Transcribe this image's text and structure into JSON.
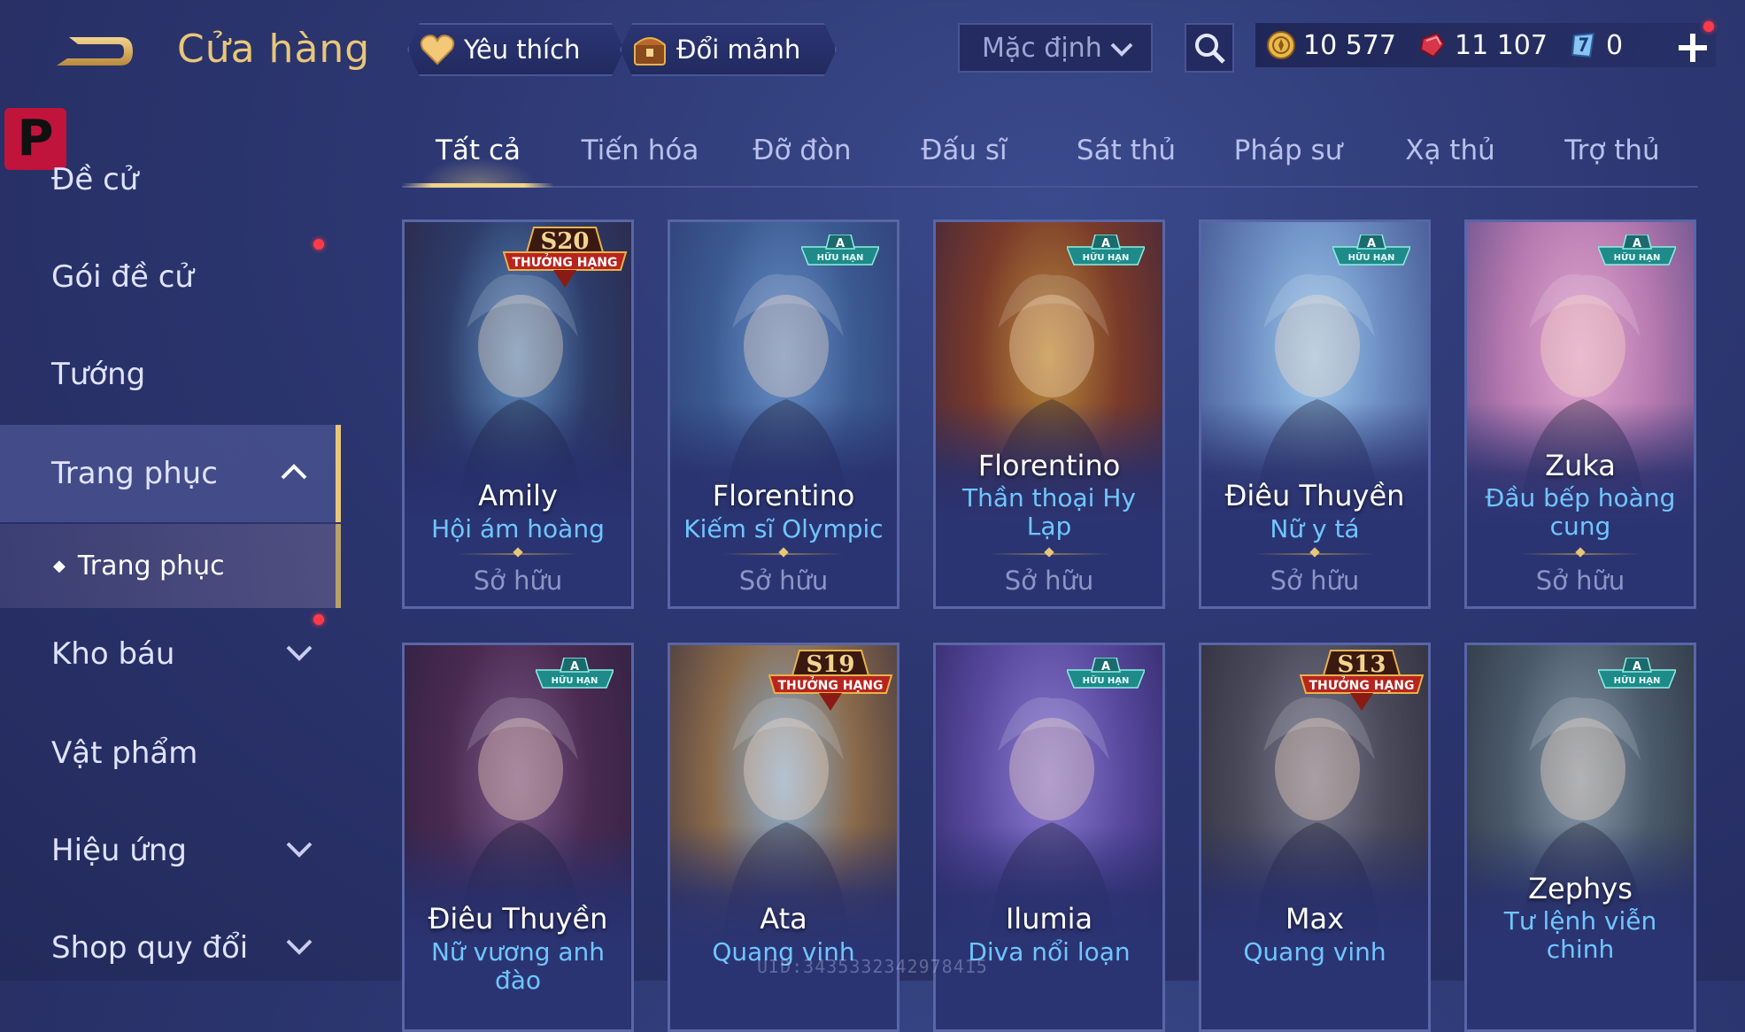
{
  "header": {
    "title": "Cửa hàng",
    "favorite_label": "Yêu thích",
    "fragment_label": "Đổi mảnh",
    "sort_value": "Mặc định",
    "currencies": [
      {
        "name": "gold-coin",
        "value": "10 577"
      },
      {
        "name": "ruby",
        "value": "11 107"
      },
      {
        "name": "voucher",
        "value": "0"
      }
    ]
  },
  "sidebar": {
    "logo_letter": "P",
    "items": [
      {
        "label": "Đề cử"
      },
      {
        "label": "Gói đề cử"
      },
      {
        "label": "Tướng"
      },
      {
        "label": "Trang phục"
      },
      {
        "label": "Trang phục"
      },
      {
        "label": "Kho báu"
      },
      {
        "label": "Vật phẩm"
      },
      {
        "label": "Hiệu ứng"
      },
      {
        "label": "Shop quy đổi"
      }
    ]
  },
  "tabs": [
    "Tất cả",
    "Tiến hóa",
    "Đỡ đòn",
    "Đấu sĩ",
    "Sát thủ",
    "Pháp sư",
    "Xạ thủ",
    "Trợ thủ"
  ],
  "cards": [
    {
      "hero": "Amily",
      "skin": "Hội ám hoàng",
      "status": "Sở hữu",
      "badge": "season",
      "season": "S20",
      "season_label": "THƯỞNG HẠNG",
      "colors": [
        "#5f8fc0",
        "#2d3c6a",
        "#2b2442"
      ]
    },
    {
      "hero": "Florentino",
      "skin": "Kiếm sĩ Olympic",
      "status": "Sở hữu",
      "badge": "limited",
      "badge_letter": "A",
      "badge_label": "HỮU HẠN",
      "colors": [
        "#6a90c8",
        "#3b5a92",
        "#2e3a70"
      ]
    },
    {
      "hero": "Florentino",
      "skin": "Thần thoại Hy Lạp",
      "status": "Sở hữu",
      "badge": "limited",
      "badge_letter": "A",
      "badge_label": "HỮU HẠN",
      "colors": [
        "#b88a3a",
        "#7a3a2a",
        "#3a2440"
      ]
    },
    {
      "hero": "Điêu Thuyền",
      "skin": "Nữ y tá",
      "status": "Sở hữu",
      "badge": "limited",
      "badge_letter": "A",
      "badge_label": "HỮU HẠN",
      "colors": [
        "#9cc8ec",
        "#6a8ac0",
        "#3c4a86"
      ]
    },
    {
      "hero": "Zuka",
      "skin": "Đầu bếp hoàng cung",
      "status": "Sở hữu",
      "badge": "limited",
      "badge_letter": "A",
      "badge_label": "HỮU HẠN",
      "colors": [
        "#e0a8d0",
        "#b87ab0",
        "#5a4a86"
      ]
    },
    {
      "hero": "Điêu Thuyền",
      "skin": "Nữ vương anh đào",
      "status": "",
      "badge": "limited",
      "badge_letter": "A",
      "badge_label": "HỮU HẠN",
      "colors": [
        "#7a5a8a",
        "#4a2a50",
        "#2a2040"
      ]
    },
    {
      "hero": "Ata",
      "skin": "Quang vinh",
      "status": "",
      "badge": "season",
      "season": "S19",
      "season_label": "THƯỞNG HẠNG",
      "colors": [
        "#8ab0d8",
        "#8a6a4a",
        "#3a3040"
      ]
    },
    {
      "hero": "Ilumia",
      "skin": "Diva nổi loạn",
      "status": "",
      "badge": "limited",
      "badge_letter": "A",
      "badge_label": "HỮU HẠN",
      "colors": [
        "#8a7ad0",
        "#5a4aa0",
        "#2a2460"
      ]
    },
    {
      "hero": "Max",
      "skin": "Quang vinh",
      "status": "",
      "badge": "season",
      "season": "S13",
      "season_label": "THƯỞNG HẠNG",
      "colors": [
        "#7a7a90",
        "#4a4a5a",
        "#2a2a3a"
      ]
    },
    {
      "hero": "Zephys",
      "skin": "Tư lệnh viễn chinh",
      "status": "",
      "badge": "limited",
      "badge_letter": "A",
      "badge_label": "HỮU HẠN",
      "colors": [
        "#8a9aac",
        "#4a5a6a",
        "#2a303e"
      ]
    }
  ],
  "watermark": "UID:3435332342978415"
}
